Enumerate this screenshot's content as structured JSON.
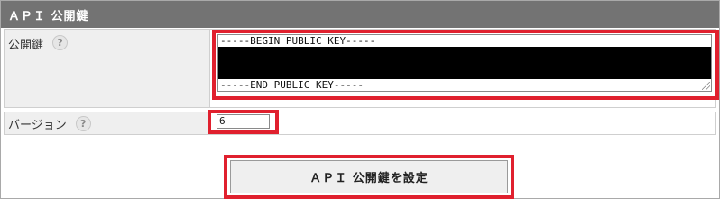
{
  "section": {
    "title": "ＡＰＩ 公開鍵"
  },
  "public_key": {
    "label": "公開鍵",
    "help_icon": "question-mark-icon",
    "begin_line": "-----BEGIN PUBLIC KEY-----",
    "end_line": "-----END PUBLIC KEY-----"
  },
  "version": {
    "label": "バージョン",
    "help_icon": "question-mark-icon",
    "value": "6"
  },
  "submit": {
    "label": "ＡＰＩ 公開鍵を設定"
  },
  "colors": {
    "header_bg": "#737373",
    "highlight": "#e0202e",
    "label_bg": "#efefef"
  }
}
